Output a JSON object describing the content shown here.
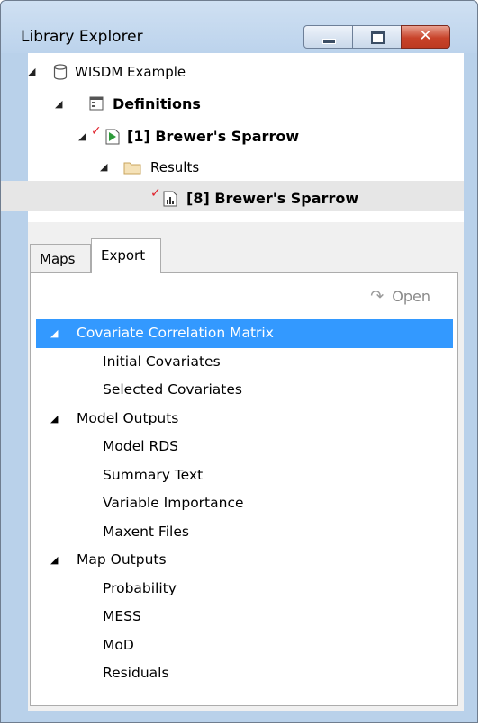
{
  "window": {
    "title": "Library Explorer",
    "close_glyph": "✕"
  },
  "tree": {
    "library": {
      "label": "WISDM Example",
      "icon": "database-icon"
    },
    "definitions": {
      "label": "Definitions",
      "icon": "definitions-icon"
    },
    "scenario": {
      "label": "[1] Brewer's Sparrow",
      "icon": "scenario-run-icon",
      "check": "✓"
    },
    "results": {
      "label": "Results",
      "icon": "folder-icon"
    },
    "result": {
      "label": "[8] Brewer's Sparrow",
      "icon": "result-chart-icon",
      "check": "✓"
    }
  },
  "tabs": {
    "maps": "Maps",
    "export": "Export",
    "active": "Export"
  },
  "toolbar": {
    "open_label": "Open",
    "open_icon": "↷"
  },
  "export_list": [
    {
      "type": "group",
      "label": "Covariate Correlation Matrix",
      "selected": true
    },
    {
      "type": "child",
      "label": "Initial Covariates"
    },
    {
      "type": "child",
      "label": "Selected Covariates"
    },
    {
      "type": "group",
      "label": "Model Outputs"
    },
    {
      "type": "child",
      "label": "Model RDS"
    },
    {
      "type": "child",
      "label": "Summary Text"
    },
    {
      "type": "child",
      "label": "Variable Importance"
    },
    {
      "type": "child",
      "label": "Maxent Files"
    },
    {
      "type": "group",
      "label": "Map Outputs"
    },
    {
      "type": "child",
      "label": "Probability"
    },
    {
      "type": "child",
      "label": "MESS"
    },
    {
      "type": "child",
      "label": "MoD"
    },
    {
      "type": "child",
      "label": "Residuals"
    }
  ],
  "colors": {
    "selection": "#3399ff",
    "window_frame": "#b9d1ea",
    "check_mark": "#e0202a",
    "folder": "#e3c48b"
  }
}
